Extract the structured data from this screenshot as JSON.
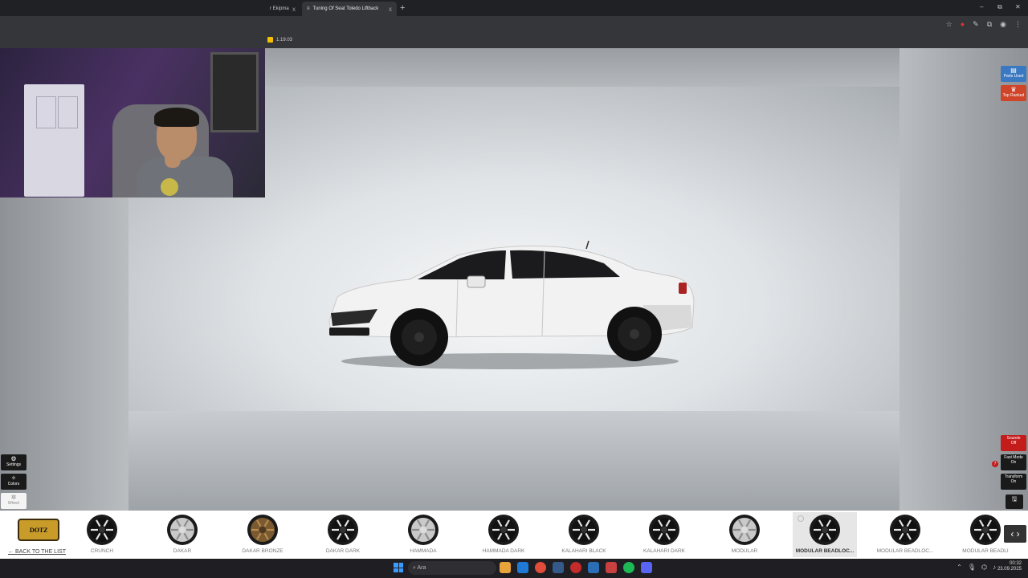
{
  "browser": {
    "tabs": [
      {
        "label": "r Ekipma",
        "active": false
      },
      {
        "label": "Tuning Of Seat Toledo Liftback",
        "active": true
      }
    ],
    "newtab_icon": "plus-icon",
    "close_icon": "x",
    "new_tab": "+",
    "window": {
      "minimize": "–",
      "restore": "⧉",
      "close": "✕"
    },
    "bookmark_version": "1.19.03"
  },
  "right_panel": {
    "parts_used": "Parts Used",
    "top_ranked": "Top Ranked",
    "sounds": "Sounds",
    "sounds_state": "Off",
    "fast_mode": "Fast Mode",
    "fast_mode_state": "On",
    "transform": "Transform",
    "transform_state": "On",
    "notification_count": "7"
  },
  "left_panel": {
    "settings": "Settings",
    "colors": "Colors",
    "wheel": "Wheel"
  },
  "wheel_bar": {
    "brand_logo": "DOTZ",
    "back_to_list": "← BACK TO THE LIST",
    "wheels": [
      {
        "name": "CRUNCH",
        "style": "dark"
      },
      {
        "name": "DAKAR",
        "style": "silver"
      },
      {
        "name": "DAKAR BRONZE",
        "style": "bronze"
      },
      {
        "name": "DAKAR DARK",
        "style": "dark"
      },
      {
        "name": "HAMMADA",
        "style": "silver"
      },
      {
        "name": "HAMMADA DARK",
        "style": "dark"
      },
      {
        "name": "KALAHARI BLACK",
        "style": "dark"
      },
      {
        "name": "KALAHARI DARK",
        "style": "dark"
      },
      {
        "name": "MODULAR",
        "style": "silver"
      },
      {
        "name": "MODULAR BEADLOC...",
        "style": "dark",
        "selected": true
      },
      {
        "name": "MODULAR BEADLOC...",
        "style": "dark"
      },
      {
        "name": "MODULAR BEADLI",
        "style": "dark"
      }
    ],
    "nav": "‹ ›"
  },
  "taskbar": {
    "search_placeholder": "Ara",
    "time": "00:32",
    "date": "23.09.2025"
  },
  "colors": {
    "sounds_off": "#c41b1b",
    "parts_used": "#3a78c2",
    "top_ranked": "#d0452a"
  }
}
